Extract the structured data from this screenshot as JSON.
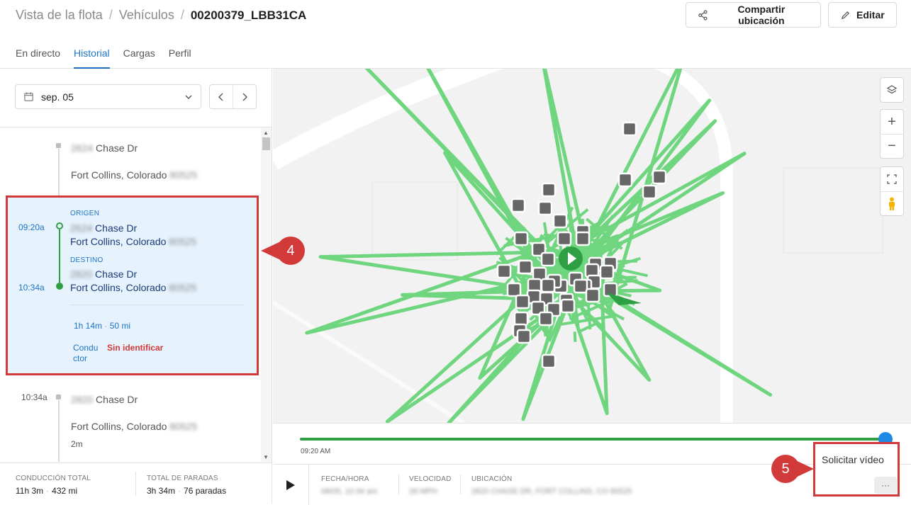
{
  "breadcrumb": {
    "items": [
      "Vista de la flota",
      "Vehículos"
    ],
    "current": "00200379_LBB31CA"
  },
  "header": {
    "share_label": "Compartir ubicación",
    "edit_label": "Editar"
  },
  "tabs": [
    "En directo",
    "Historial",
    "Cargas",
    "Perfil"
  ],
  "date_selector": {
    "value": "sep. 05"
  },
  "stops": [
    {
      "street_num": "2624",
      "street": " Chase Dr",
      "city": "Fort Collins, Colorado",
      "zip": "80525",
      "time": ""
    },
    {
      "street_num": "2820",
      "street": " Chase Dr",
      "city": "Fort Collins, Colorado",
      "zip": "80525",
      "time": "10:34a",
      "duration": "2m"
    }
  ],
  "trip": {
    "origin_label": "ORIGEN",
    "dest_label": "DESTINO",
    "start_time": "09:20a",
    "end_time": "10:34a",
    "origin_num": "2624",
    "origin_street": " Chase Dr",
    "origin_city": "Fort Collins, Colorado",
    "origin_zip": "80525",
    "dest_num": "2820",
    "dest_street": " Chase Dr",
    "dest_city": "Fort Collins, Colorado",
    "dest_zip": "80525",
    "duration": "1h 14m",
    "distance": "50 mi",
    "driver_label": "Conductor",
    "driver_value": "Sin identificar"
  },
  "summary": {
    "driving_label": "CONDUCCIÓN TOTAL",
    "driving_time": "11h 3m",
    "driving_distance": "432 mi",
    "stops_label": "TOTAL DE PARADAS",
    "stops_time": "3h 34m",
    "stops_count": "76 paradas"
  },
  "timeline": {
    "start_time": "09:20 AM",
    "progress": 1.0
  },
  "info": {
    "datetime_label": "FECHA/HORA",
    "datetime_value": "08/05, 10:34 am",
    "speed_label": "VELOCIDAD",
    "speed_value": "28 MPH",
    "location_label": "UBICACIÓN",
    "location_value": "2820 CHASE DR, FORT COLLINS, CO 80525"
  },
  "request_video": {
    "label": "Solicitar vídeo",
    "more": "···"
  },
  "callouts": [
    "4",
    "5"
  ],
  "colors": {
    "accent": "#1d74c9",
    "route": "#6fd67f",
    "annotation": "#d23a3a",
    "progress": "#2ea043",
    "knob": "#1e88e5"
  },
  "icons": [
    "share-icon",
    "pencil-icon",
    "calendar-icon",
    "chevron-down-icon",
    "chevron-left-icon",
    "chevron-right-icon",
    "layers-icon",
    "zoom-in-icon",
    "zoom-out-icon",
    "fullscreen-icon",
    "pegman-icon",
    "play-icon",
    "vehicle-arrow-icon"
  ]
}
